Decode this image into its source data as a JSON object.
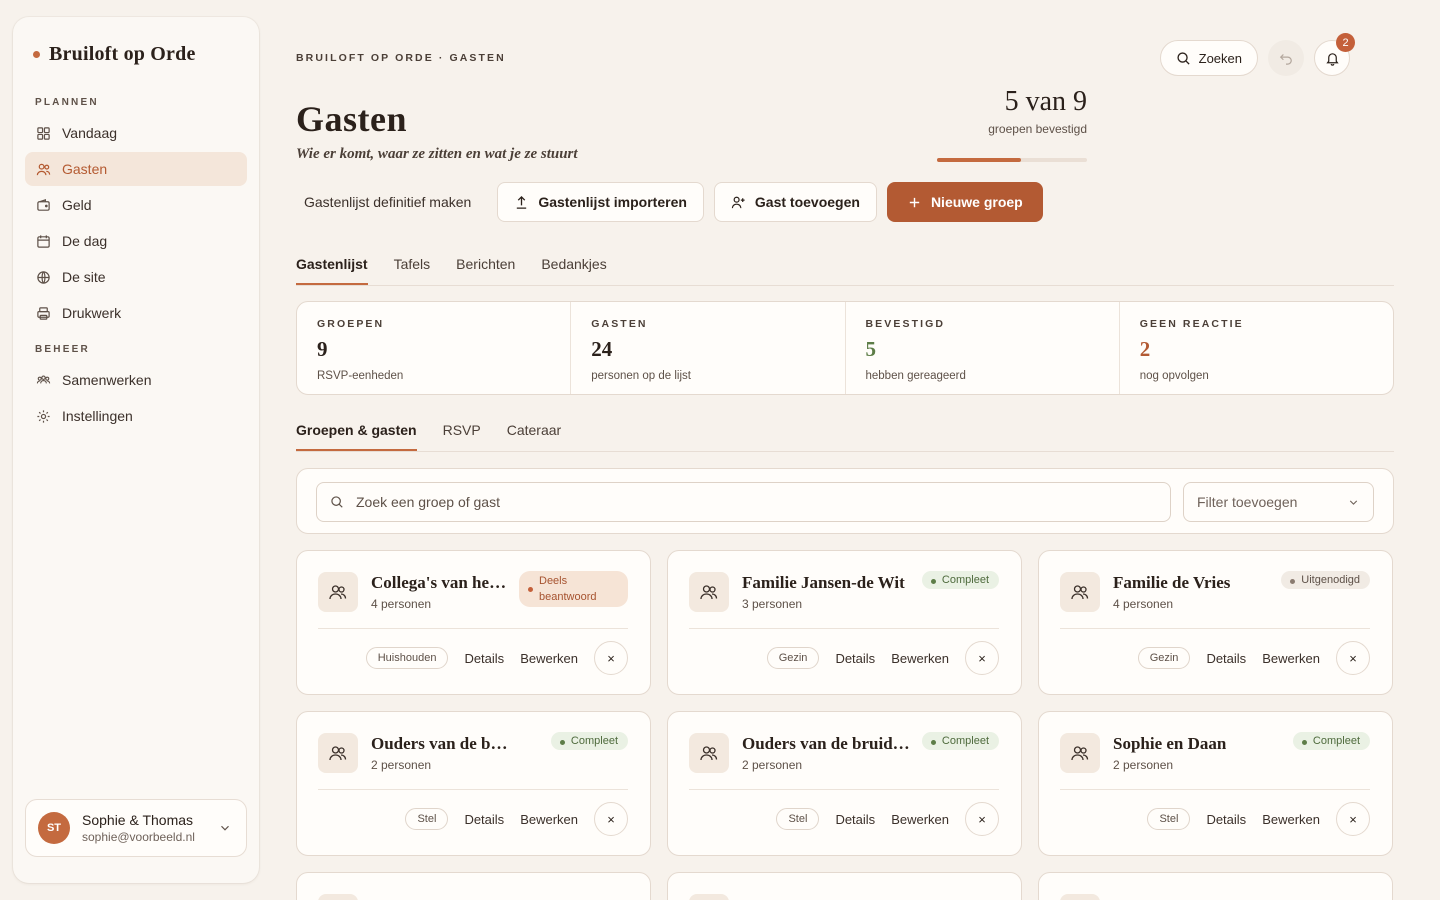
{
  "sidebar": {
    "brand": "Bruiloft op Orde",
    "section_plan": "PLANNEN",
    "section_manage": "BEHEER",
    "items": [
      {
        "label": "Vandaag",
        "icon": "grid-icon"
      },
      {
        "label": "Gasten",
        "icon": "users-icon"
      },
      {
        "label": "Geld",
        "icon": "wallet-icon"
      },
      {
        "label": "De dag",
        "icon": "calendar-icon"
      },
      {
        "label": "De site",
        "icon": "globe-icon"
      },
      {
        "label": "Drukwerk",
        "icon": "printer-icon"
      },
      {
        "label": "Samenwerken",
        "icon": "team-icon"
      },
      {
        "label": "Instellingen",
        "icon": "gear-icon"
      }
    ],
    "user": {
      "initials": "ST",
      "name": "Sophie & Thomas",
      "email": "sophie@voorbeeld.nl"
    }
  },
  "header": {
    "breadcrumb": "BRUILOFT OP ORDE · GASTEN",
    "title": "Gasten",
    "subtitle": "Wie er komt, waar ze zitten en wat je ze stuurt",
    "search_label": "Zoeken",
    "notifications": "2",
    "progress_big": "5 van 9",
    "progress_label": "groepen bevestigd",
    "progress_fraction": 0.56
  },
  "actions": {
    "finalize": "Gastenlijst definitief maken",
    "import": "Gastenlijst importeren",
    "add_guest": "Gast toevoegen",
    "new_group": "Nieuwe groep"
  },
  "tabs": [
    "Gastenlijst",
    "Tafels",
    "Berichten",
    "Bedankjes"
  ],
  "stats": [
    {
      "label": "GROEPEN",
      "value": "9",
      "note": "RSVP-eenheden",
      "color": "#2b211b"
    },
    {
      "label": "GASTEN",
      "value": "24",
      "note": "personen op de lijst",
      "color": "#2b211b"
    },
    {
      "label": "BEVESTIGD",
      "value": "5",
      "note": "hebben gereageerd",
      "color": "#5d7d47"
    },
    {
      "label": "GEEN REACTIE",
      "value": "2",
      "note": "nog opvolgen",
      "color": "#b35a33"
    }
  ],
  "subtabs": [
    "Groepen & gasten",
    "RSVP",
    "Cateraar"
  ],
  "search": {
    "placeholder": "Zoek een groep of gast",
    "filter": "Filter toevoegen"
  },
  "card_actions": {
    "details": "Details",
    "edit": "Bewerken",
    "remove": "×"
  },
  "groups": [
    {
      "name": "Collega's van het…",
      "count": "4 personen",
      "status": "Deels beantwoord",
      "status_type": "part",
      "tag": "Huishouden"
    },
    {
      "name": "Familie Jansen-de Wit",
      "count": "3 personen",
      "status": "Compleet",
      "status_type": "ok",
      "tag": "Gezin"
    },
    {
      "name": "Familie de Vries",
      "count": "4 personen",
      "status": "Uitgenodigd",
      "status_type": "inv",
      "tag": "Gezin"
    },
    {
      "name": "Ouders van de bruid",
      "count": "2 personen",
      "status": "Compleet",
      "status_type": "ok",
      "tag": "Stel"
    },
    {
      "name": "Ouders van de bruid…",
      "count": "2 personen",
      "status": "Compleet",
      "status_type": "ok",
      "tag": "Stel"
    },
    {
      "name": "Sophie en Daan",
      "count": "2 personen",
      "status": "Compleet",
      "status_type": "ok",
      "tag": "Stel"
    }
  ]
}
